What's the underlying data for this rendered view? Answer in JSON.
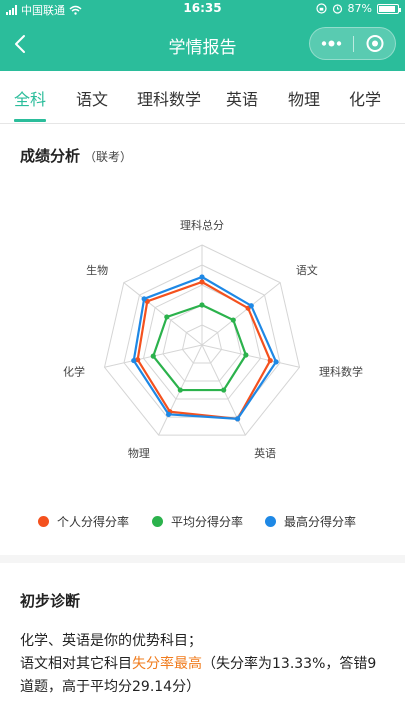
{
  "status_bar": {
    "carrier": "中国联通",
    "time": "16:35",
    "battery": "87%"
  },
  "nav": {
    "title": "学情报告"
  },
  "tabs": [
    {
      "label": "全科",
      "active": true
    },
    {
      "label": "语文"
    },
    {
      "label": "理科数学"
    },
    {
      "label": "英语"
    },
    {
      "label": "物理"
    },
    {
      "label": "化学"
    }
  ],
  "section": {
    "title": "成绩分析",
    "subtitle": "（联考）"
  },
  "chart_data": {
    "type": "radar",
    "axes": [
      "理科总分",
      "语文",
      "理科数学",
      "英语",
      "物理",
      "化学",
      "生物"
    ],
    "rmax": 100,
    "series": [
      {
        "name": "个人分得分率",
        "color": "#f4511e",
        "values": [
          63,
          59,
          70,
          82,
          74,
          66,
          70
        ]
      },
      {
        "name": "平均分得分率",
        "color": "#2bb24c",
        "values": [
          40,
          40,
          45,
          50,
          50,
          50,
          45
        ]
      },
      {
        "name": "最高分得分率",
        "color": "#1e88e5",
        "values": [
          68,
          63,
          76,
          82,
          77,
          70,
          74
        ]
      }
    ]
  },
  "diagnosis": {
    "title": "初步诊断",
    "line1": "化学、英语是你的优势科目；",
    "line2_prefix": "语文相对其它科目",
    "line2_highlight": "失分率最高",
    "line2_suffix": "（失分率为13.33%，答错9道题，高于平均分29.14分）"
  }
}
